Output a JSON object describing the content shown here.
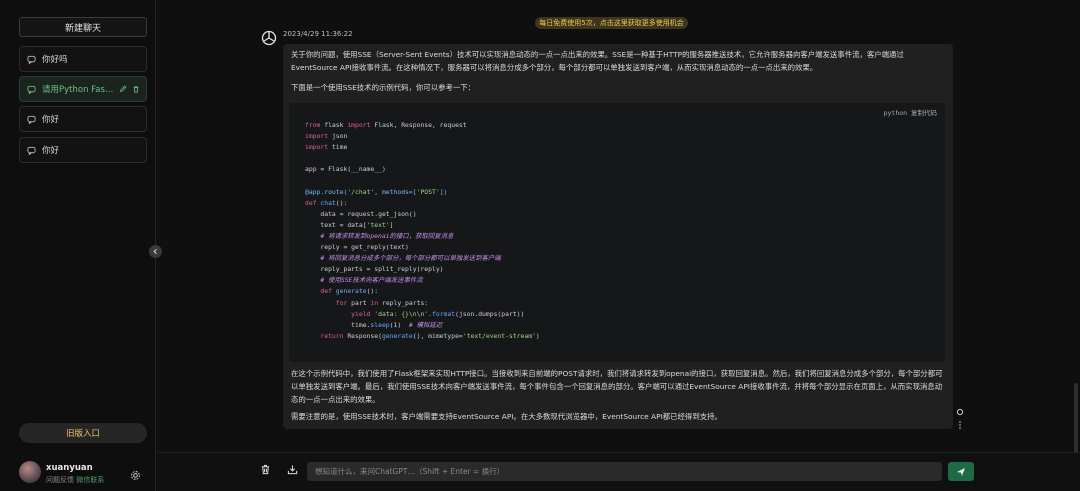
{
  "sidebar": {
    "new_chat": "新建聊天",
    "items": [
      {
        "label": "你好吗"
      },
      {
        "label": "请用Python FastA..."
      },
      {
        "label": "你好"
      },
      {
        "label": "你好"
      }
    ],
    "old_entry": "旧版入口",
    "user": {
      "name": "xuanyuan",
      "feedback": "问题反馈",
      "wechat": "微信联系"
    }
  },
  "banner": "每日免费使用5次，点击这里获取更多使用机会",
  "message": {
    "timestamp": "2023/4/29 11:36:22",
    "intro": "关于你的问题，使用SSE（Server-Sent Events）技术可以实现消息动态的一点一点出来的效果。SSE是一种基于HTTP的服务器推送技术，它允许服务器向客户端发送事件流，客户端通过EventSource API接收事件流。在这种情况下，服务器可以将消息分成多个部分，每个部分都可以单独发送到客户端，从而实现消息动态的一点一点出来的效果。",
    "lead": "下面是一个使用SSE技术的示例代码，你可以参考一下：",
    "code_lang": "python",
    "copy_label": "复制代码",
    "code_lines": [
      "from flask import Flask, Response, request",
      "import json",
      "import time",
      "",
      "app = Flask(__name__)",
      "",
      "@app.route('/chat', methods=['POST'])",
      "def chat():",
      "    data = request.get_json()",
      "    text = data['text']",
      "    # 将请求转发到openai的接口，获取回复消息",
      "    reply = get_reply(text)",
      "    # 将回复消息分成多个部分，每个部分都可以单独发送到客户端",
      "    reply_parts = split_reply(reply)",
      "    # 使用SSE技术向客户端发送事件流",
      "    def generate():",
      "        for part in reply_parts:",
      "            yield 'data: {}\\n\\n'.format(json.dumps(part))",
      "            time.sleep(1)  # 模拟延迟",
      "    return Response(generate(), mimetype='text/event-stream')"
    ],
    "explain": "在这个示例代码中，我们使用了Flask框架来实现HTTP接口。当接收到来自前端的POST请求时，我们将请求转发到openai的接口，获取回复消息。然后，我们将回复消息分成多个部分，每个部分都可以单独发送到客户端。最后，我们使用SSE技术向客户端发送事件流，每个事件包含一个回复消息的部分。客户端可以通过EventSource API接收事件流，并将每个部分显示在页面上，从而实现消息动态的一点一点出来的效果。",
    "note": "需要注意的是，使用SSE技术时，客户端需要支持EventSource API。在大多数现代浏览器中，EventSource API都已经得到支持。"
  },
  "input": {
    "placeholder": "想知道什么，来问ChatGPT…（Shift + Enter = 换行）"
  },
  "colors": {
    "accent": "#1d6a44",
    "banner_text": "#f2c74a",
    "old_entry_text": "#f0c36a"
  }
}
